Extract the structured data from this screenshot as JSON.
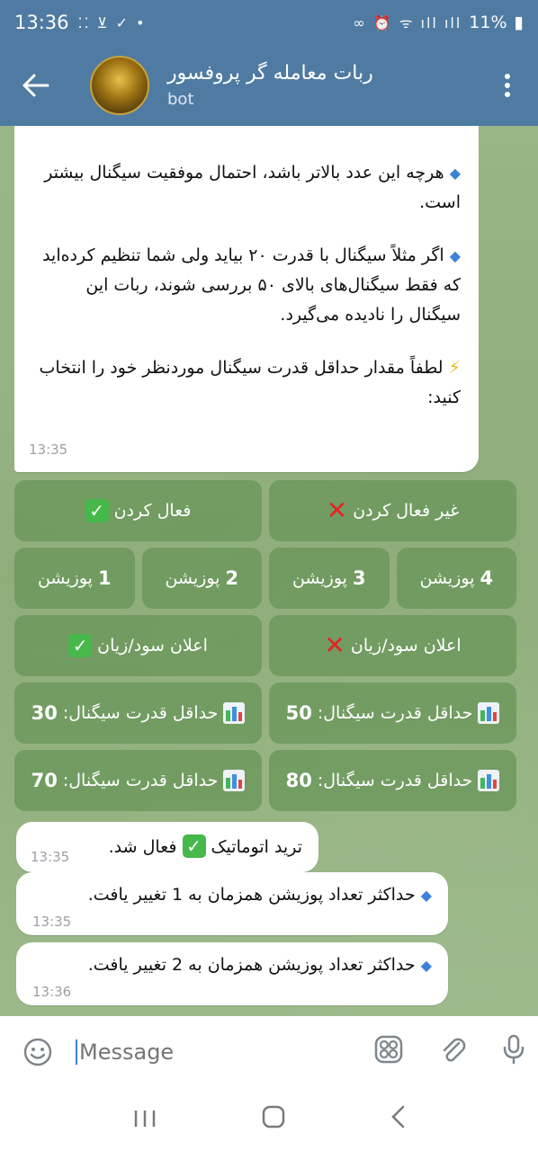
{
  "status_bar": {
    "time": "13:36",
    "left_icons": "⁚⁚ ⊻ ✓ •",
    "right_icons": "∞ ⏰ ᯤ ıll ıll",
    "battery": "11%"
  },
  "header": {
    "title": "ربات معامله گر پروفسور",
    "subtitle": "bot"
  },
  "messages": {
    "main": {
      "para1": "هرچه این عدد بالاتر باشد، احتمال موفقیت سیگنال بیشتر است.",
      "para2": "اگر مثلاً سیگنال با قدرت ۲۰ بیاید ولی شما تنظیم کرده‌اید که فقط سیگنال‌های بالای ۵۰ بررسی شوند، ربات این سیگنال را نادیده می‌گیرد.",
      "para3": "لطفاً مقدار حداقل قدرت سیگنال موردنظر خود را انتخاب کنید:",
      "time": "13:35"
    },
    "auto_trade": {
      "text_a": "ترید اتوماتیک",
      "text_b": "فعال شد.",
      "time": "13:35"
    },
    "positions1": {
      "text": "حداکثر تعداد پوزیشن همزمان به 1 تغییر یافت.",
      "time": "13:35"
    },
    "positions2": {
      "text": "حداکثر تعداد پوزیشن همزمان به 2 تغییر یافت.",
      "time": "13:36"
    }
  },
  "keyboard": {
    "disable": "غیر فعال کردن",
    "enable": "فعال کردن",
    "pos4_num": "4",
    "pos4_label": "پوزیشن",
    "pos3_num": "3",
    "pos3_label": "پوزیشن",
    "pos2_num": "2",
    "pos2_label": "پوزیشن",
    "pos1_num": "1",
    "pos1_label": "پوزیشن",
    "pnl_off": "اعلان سود/زیان",
    "pnl_on": "اعلان سود/زیان",
    "min_label": "حداقل قدرت سیگنال:",
    "min50": "50",
    "min30": "30",
    "min80": "80",
    "min70": "70"
  },
  "input": {
    "placeholder": "Message"
  },
  "colors": {
    "header": "#4f7ba3",
    "button": "#6a965a",
    "accent": "#3b82d8"
  },
  "icons": [
    "back-arrow-icon",
    "more-vert-icon",
    "emoji-icon",
    "sticker-icon",
    "attach-icon",
    "mic-icon",
    "check-icon",
    "cross-icon",
    "chart-icon",
    "diamond-icon",
    "bolt-icon"
  ]
}
